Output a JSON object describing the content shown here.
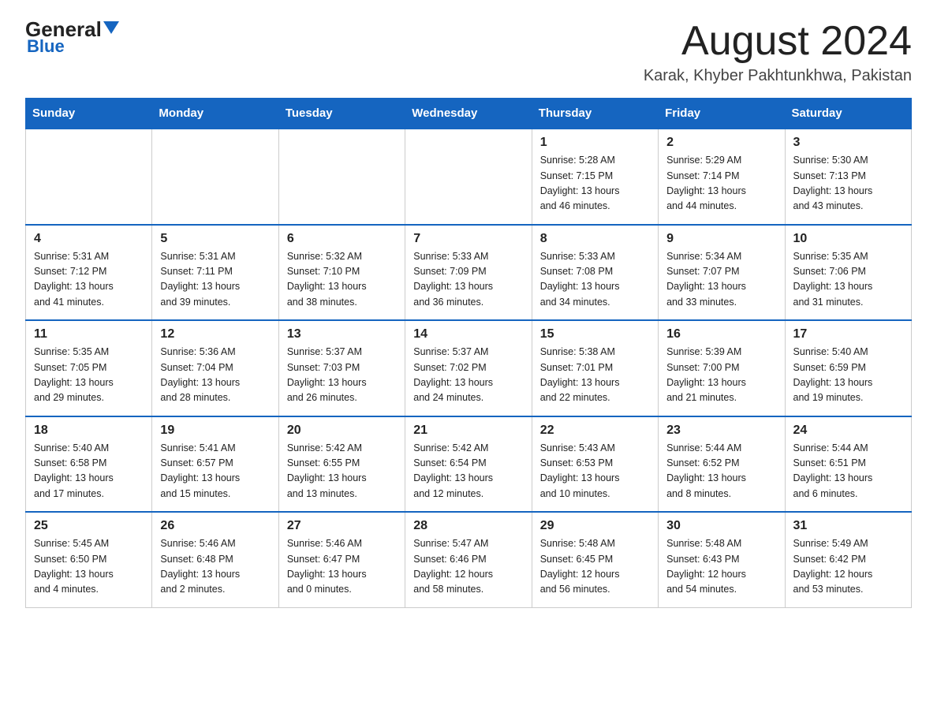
{
  "logo": {
    "general": "General",
    "blue": "Blue",
    "triangle": "▼"
  },
  "header": {
    "title": "August 2024",
    "subtitle": "Karak, Khyber Pakhtunkhwa, Pakistan"
  },
  "days_of_week": [
    "Sunday",
    "Monday",
    "Tuesday",
    "Wednesday",
    "Thursday",
    "Friday",
    "Saturday"
  ],
  "weeks": [
    [
      {
        "day": "",
        "info": ""
      },
      {
        "day": "",
        "info": ""
      },
      {
        "day": "",
        "info": ""
      },
      {
        "day": "",
        "info": ""
      },
      {
        "day": "1",
        "info": "Sunrise: 5:28 AM\nSunset: 7:15 PM\nDaylight: 13 hours\nand 46 minutes."
      },
      {
        "day": "2",
        "info": "Sunrise: 5:29 AM\nSunset: 7:14 PM\nDaylight: 13 hours\nand 44 minutes."
      },
      {
        "day": "3",
        "info": "Sunrise: 5:30 AM\nSunset: 7:13 PM\nDaylight: 13 hours\nand 43 minutes."
      }
    ],
    [
      {
        "day": "4",
        "info": "Sunrise: 5:31 AM\nSunset: 7:12 PM\nDaylight: 13 hours\nand 41 minutes."
      },
      {
        "day": "5",
        "info": "Sunrise: 5:31 AM\nSunset: 7:11 PM\nDaylight: 13 hours\nand 39 minutes."
      },
      {
        "day": "6",
        "info": "Sunrise: 5:32 AM\nSunset: 7:10 PM\nDaylight: 13 hours\nand 38 minutes."
      },
      {
        "day": "7",
        "info": "Sunrise: 5:33 AM\nSunset: 7:09 PM\nDaylight: 13 hours\nand 36 minutes."
      },
      {
        "day": "8",
        "info": "Sunrise: 5:33 AM\nSunset: 7:08 PM\nDaylight: 13 hours\nand 34 minutes."
      },
      {
        "day": "9",
        "info": "Sunrise: 5:34 AM\nSunset: 7:07 PM\nDaylight: 13 hours\nand 33 minutes."
      },
      {
        "day": "10",
        "info": "Sunrise: 5:35 AM\nSunset: 7:06 PM\nDaylight: 13 hours\nand 31 minutes."
      }
    ],
    [
      {
        "day": "11",
        "info": "Sunrise: 5:35 AM\nSunset: 7:05 PM\nDaylight: 13 hours\nand 29 minutes."
      },
      {
        "day": "12",
        "info": "Sunrise: 5:36 AM\nSunset: 7:04 PM\nDaylight: 13 hours\nand 28 minutes."
      },
      {
        "day": "13",
        "info": "Sunrise: 5:37 AM\nSunset: 7:03 PM\nDaylight: 13 hours\nand 26 minutes."
      },
      {
        "day": "14",
        "info": "Sunrise: 5:37 AM\nSunset: 7:02 PM\nDaylight: 13 hours\nand 24 minutes."
      },
      {
        "day": "15",
        "info": "Sunrise: 5:38 AM\nSunset: 7:01 PM\nDaylight: 13 hours\nand 22 minutes."
      },
      {
        "day": "16",
        "info": "Sunrise: 5:39 AM\nSunset: 7:00 PM\nDaylight: 13 hours\nand 21 minutes."
      },
      {
        "day": "17",
        "info": "Sunrise: 5:40 AM\nSunset: 6:59 PM\nDaylight: 13 hours\nand 19 minutes."
      }
    ],
    [
      {
        "day": "18",
        "info": "Sunrise: 5:40 AM\nSunset: 6:58 PM\nDaylight: 13 hours\nand 17 minutes."
      },
      {
        "day": "19",
        "info": "Sunrise: 5:41 AM\nSunset: 6:57 PM\nDaylight: 13 hours\nand 15 minutes."
      },
      {
        "day": "20",
        "info": "Sunrise: 5:42 AM\nSunset: 6:55 PM\nDaylight: 13 hours\nand 13 minutes."
      },
      {
        "day": "21",
        "info": "Sunrise: 5:42 AM\nSunset: 6:54 PM\nDaylight: 13 hours\nand 12 minutes."
      },
      {
        "day": "22",
        "info": "Sunrise: 5:43 AM\nSunset: 6:53 PM\nDaylight: 13 hours\nand 10 minutes."
      },
      {
        "day": "23",
        "info": "Sunrise: 5:44 AM\nSunset: 6:52 PM\nDaylight: 13 hours\nand 8 minutes."
      },
      {
        "day": "24",
        "info": "Sunrise: 5:44 AM\nSunset: 6:51 PM\nDaylight: 13 hours\nand 6 minutes."
      }
    ],
    [
      {
        "day": "25",
        "info": "Sunrise: 5:45 AM\nSunset: 6:50 PM\nDaylight: 13 hours\nand 4 minutes."
      },
      {
        "day": "26",
        "info": "Sunrise: 5:46 AM\nSunset: 6:48 PM\nDaylight: 13 hours\nand 2 minutes."
      },
      {
        "day": "27",
        "info": "Sunrise: 5:46 AM\nSunset: 6:47 PM\nDaylight: 13 hours\nand 0 minutes."
      },
      {
        "day": "28",
        "info": "Sunrise: 5:47 AM\nSunset: 6:46 PM\nDaylight: 12 hours\nand 58 minutes."
      },
      {
        "day": "29",
        "info": "Sunrise: 5:48 AM\nSunset: 6:45 PM\nDaylight: 12 hours\nand 56 minutes."
      },
      {
        "day": "30",
        "info": "Sunrise: 5:48 AM\nSunset: 6:43 PM\nDaylight: 12 hours\nand 54 minutes."
      },
      {
        "day": "31",
        "info": "Sunrise: 5:49 AM\nSunset: 6:42 PM\nDaylight: 12 hours\nand 53 minutes."
      }
    ]
  ]
}
